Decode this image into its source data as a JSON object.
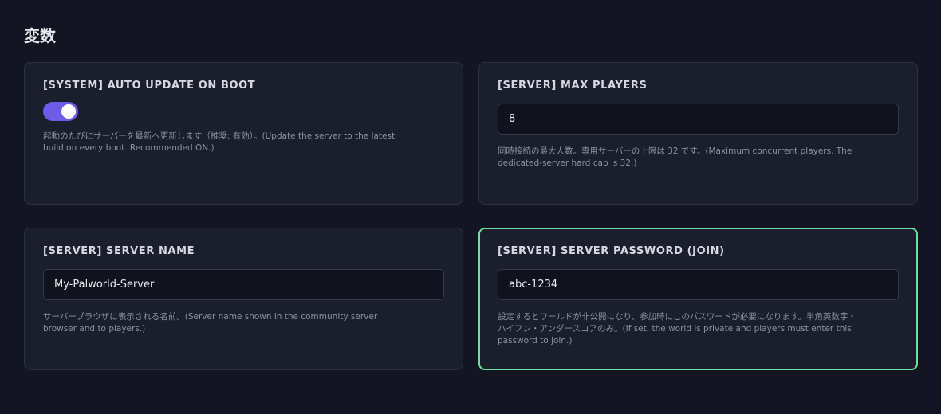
{
  "page": {
    "title": "変数"
  },
  "colors": {
    "background": "#131622",
    "card": "#1a1e2d",
    "accent_toggle": "#6c5ce7",
    "focus_border": "#6fe0a4"
  },
  "variables": [
    {
      "label": "[SYSTEM] AUTO UPDATE ON BOOT",
      "type": "toggle",
      "value": true,
      "help": "起動のたびにサーバーを最新へ更新します（推奨: 有効）。(Update the server to the latest build on every boot. Recommended ON.)"
    },
    {
      "label": "[SERVER] MAX PLAYERS",
      "type": "text",
      "value": "8",
      "help": "同時接続の最大人数。専用サーバーの上限は 32 です。(Maximum concurrent players. The dedicated-server hard cap is 32.)"
    },
    {
      "label": "[SERVER] SERVER NAME",
      "type": "text",
      "value": "My-Palworld-Server",
      "help": "サーバーブラウザに表示される名前。(Server name shown in the community server browser and to players.)"
    },
    {
      "label": "[SERVER] SERVER PASSWORD (JOIN)",
      "type": "text",
      "value": "abc-1234",
      "help": "設定するとワールドが非公開になり、参加時にこのパスワードが必要になります。半角英数字・ハイフン・アンダースコアのみ。(If set, the world is private and players must enter this password to join.)"
    }
  ]
}
